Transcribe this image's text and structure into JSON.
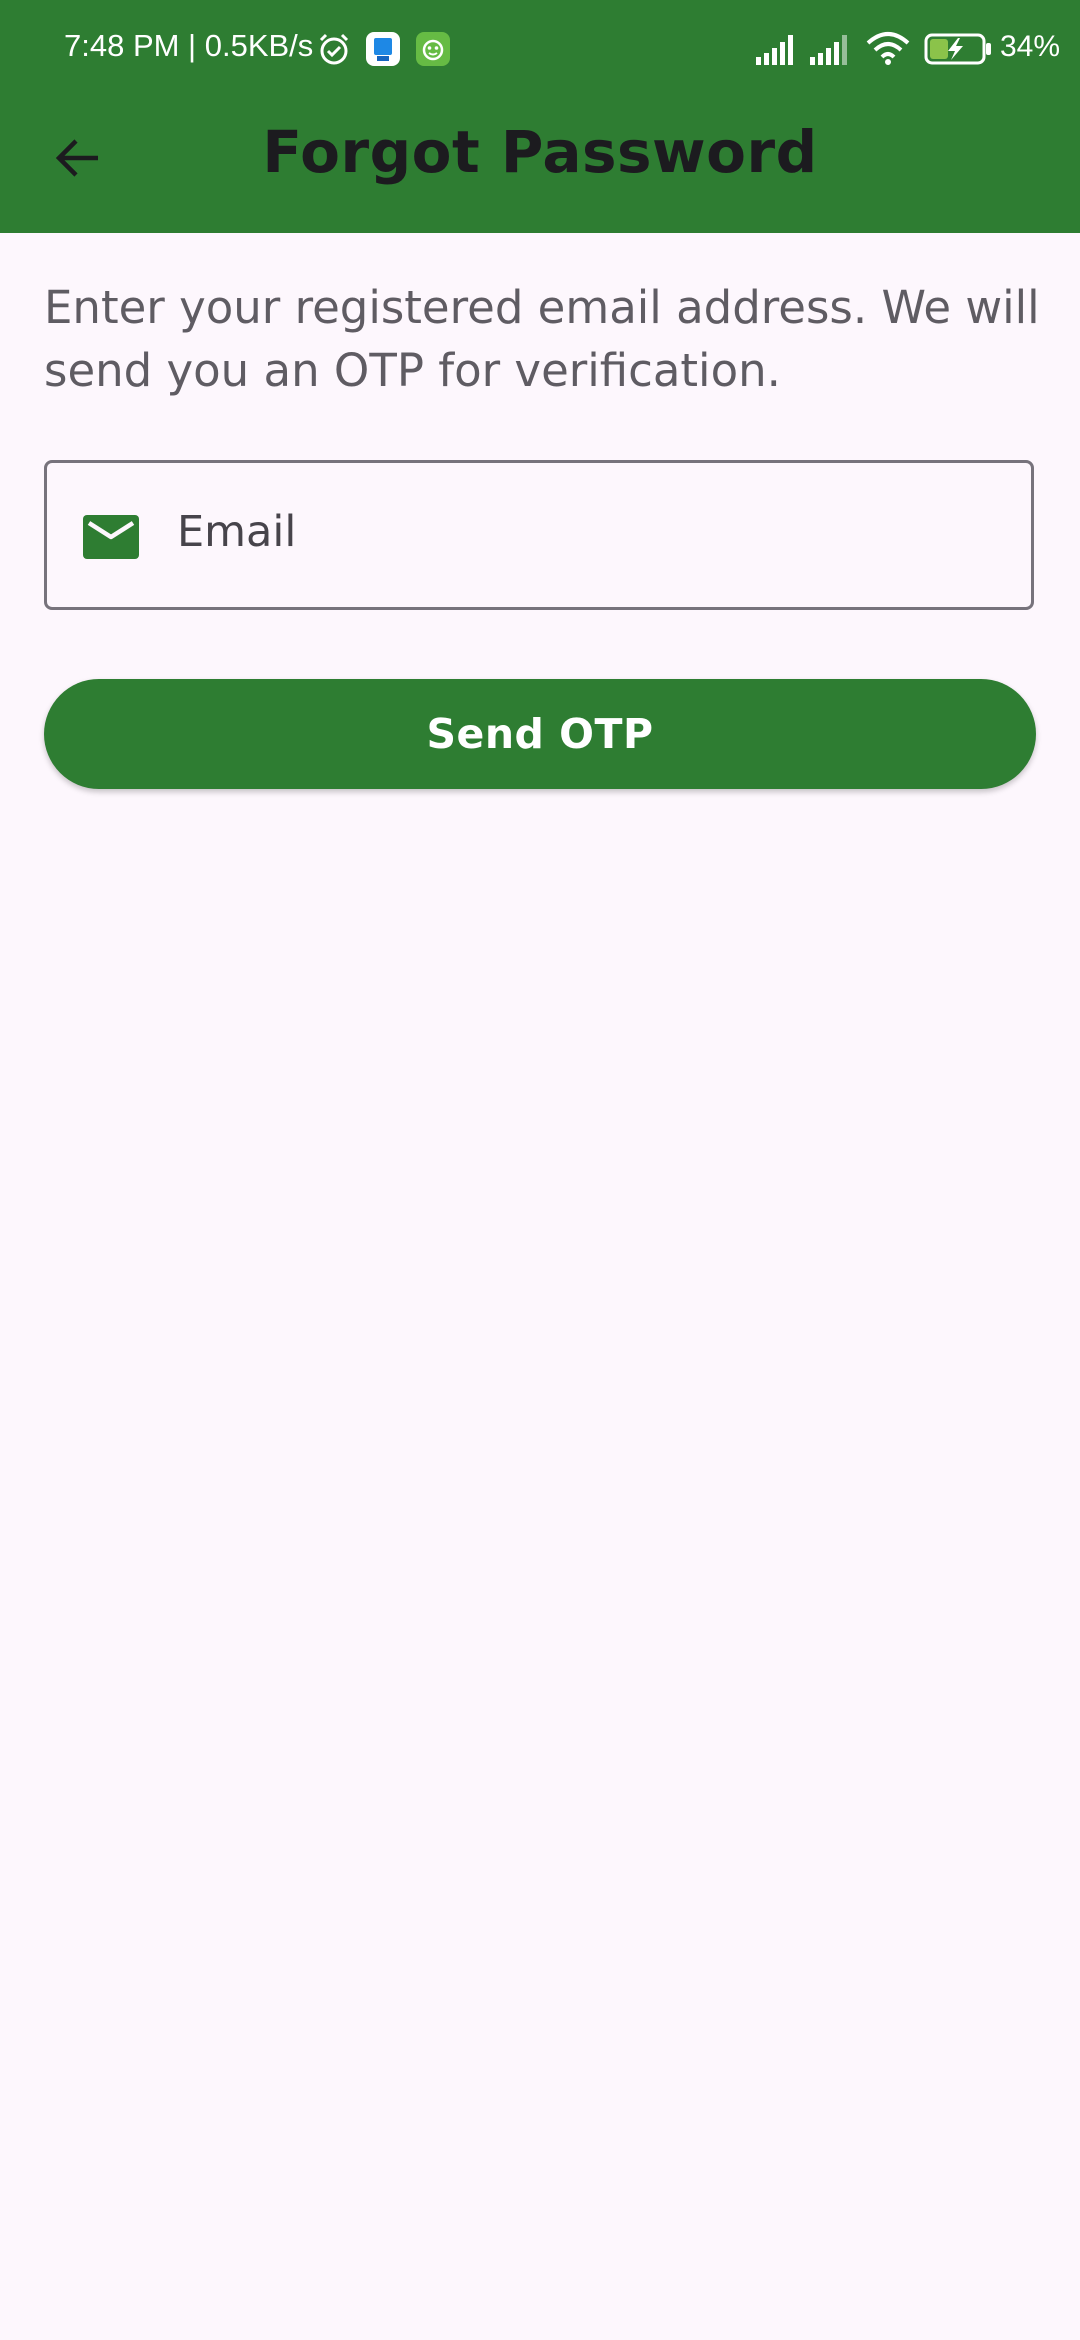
{
  "status_bar": {
    "time": "7:48 PM | 0.5KB/s",
    "battery_percent": "34%",
    "battery_level": 0.34,
    "icons": [
      "alarm-icon",
      "app-notification-icon",
      "android-notification-icon",
      "signal-icon",
      "signal-icon",
      "wifi-icon",
      "battery-charging-icon"
    ]
  },
  "app_bar": {
    "title": "Forgot Password",
    "back_icon": "arrow-back-icon"
  },
  "content": {
    "instruction": "Enter your registered email address. We will send you an OTP for verification.",
    "email_field": {
      "placeholder": "Email",
      "value": "",
      "icon": "mail-icon"
    },
    "send_button_label": "Send OTP"
  },
  "colors": {
    "primary": "#2e7d32",
    "background": "#fdf7fd",
    "title_text": "#1c1b1f",
    "body_text": "#5f5c63"
  }
}
